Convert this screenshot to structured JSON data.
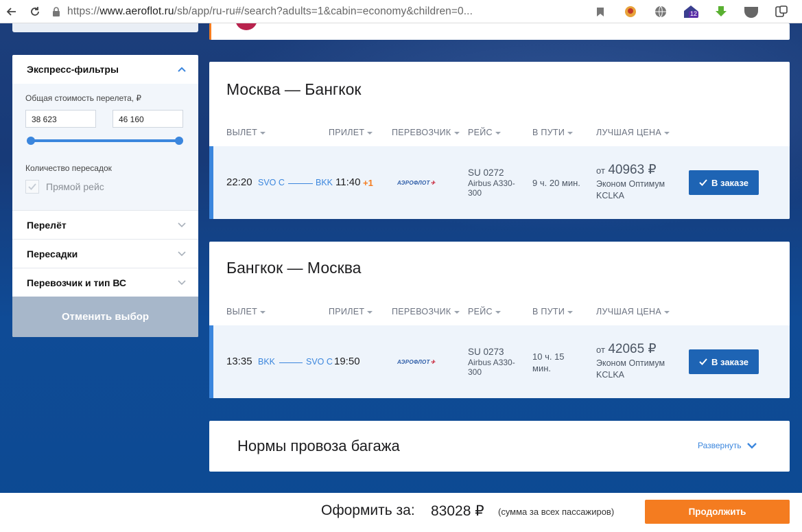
{
  "browser": {
    "url_prefix": "https://",
    "url_host": "www.aeroflot.ru",
    "url_path": "/sb/app/ru-ru#/search?adults=1&cabin=economy&children=0...",
    "ext_badge": "12"
  },
  "sidebar": {
    "express_title": "Экспресс-фильтры",
    "price_label": "Общая стоимость перелета, ₽",
    "price_min": "38 623",
    "price_max": "46 160",
    "transfers_label": "Количество пересадок",
    "direct_label": "Прямой рейс",
    "items": [
      {
        "label": "Перелёт"
      },
      {
        "label": "Пересадки"
      },
      {
        "label": "Перевозчик и тип ВС"
      }
    ],
    "cancel_label": "Отменить выбор"
  },
  "columns": {
    "depart": "ВЫЛЕТ",
    "arrive": "ПРИЛЕТ",
    "carrier": "ПЕРЕВОЗЧИК",
    "flight": "РЕЙС",
    "duration": "В ПУТИ",
    "best_price": "ЛУЧШАЯ ЦЕНА"
  },
  "routes": [
    {
      "title": "Москва — Бангкок",
      "dep_time": "22:20",
      "dep_code": "SVO C",
      "arr_code": "BKK",
      "arr_time": "11:40",
      "plus_day": "+1",
      "airline": "АЭРОФЛОТ",
      "flight_no": "SU 0272",
      "aircraft": "Airbus A330-300",
      "duration": "9 ч. 20 мин.",
      "price_from": "от",
      "price": "40963 ₽",
      "fare": "Эконом Оптимум",
      "fare_code": "KCLKA",
      "button": "В заказе"
    },
    {
      "title": "Бангкок — Москва",
      "dep_time": "13:35",
      "dep_code": "BKK",
      "arr_code": "SVO C",
      "arr_time": "19:50",
      "airline": "АЭРОФЛОТ",
      "flight_no": "SU 0273",
      "aircraft": "Airbus A330-300",
      "duration": "10 ч. 15 мин.",
      "price_from": "от",
      "price": "42065 ₽",
      "fare": "Эконом Оптимум",
      "fare_code": "KCLKA",
      "button": "В заказе"
    }
  ],
  "baggage": {
    "title": "Нормы провоза багажа",
    "expand_label": "Развернуть"
  },
  "footer": {
    "total_label": "Оформить за:",
    "total_value": "83028 ₽",
    "note": "(сумма за всех пассажиров)",
    "continue_label": "Продолжить"
  },
  "colors": {
    "accent": "#3b86dd",
    "orange": "#f47c20",
    "button_blue": "#1e64b4"
  }
}
